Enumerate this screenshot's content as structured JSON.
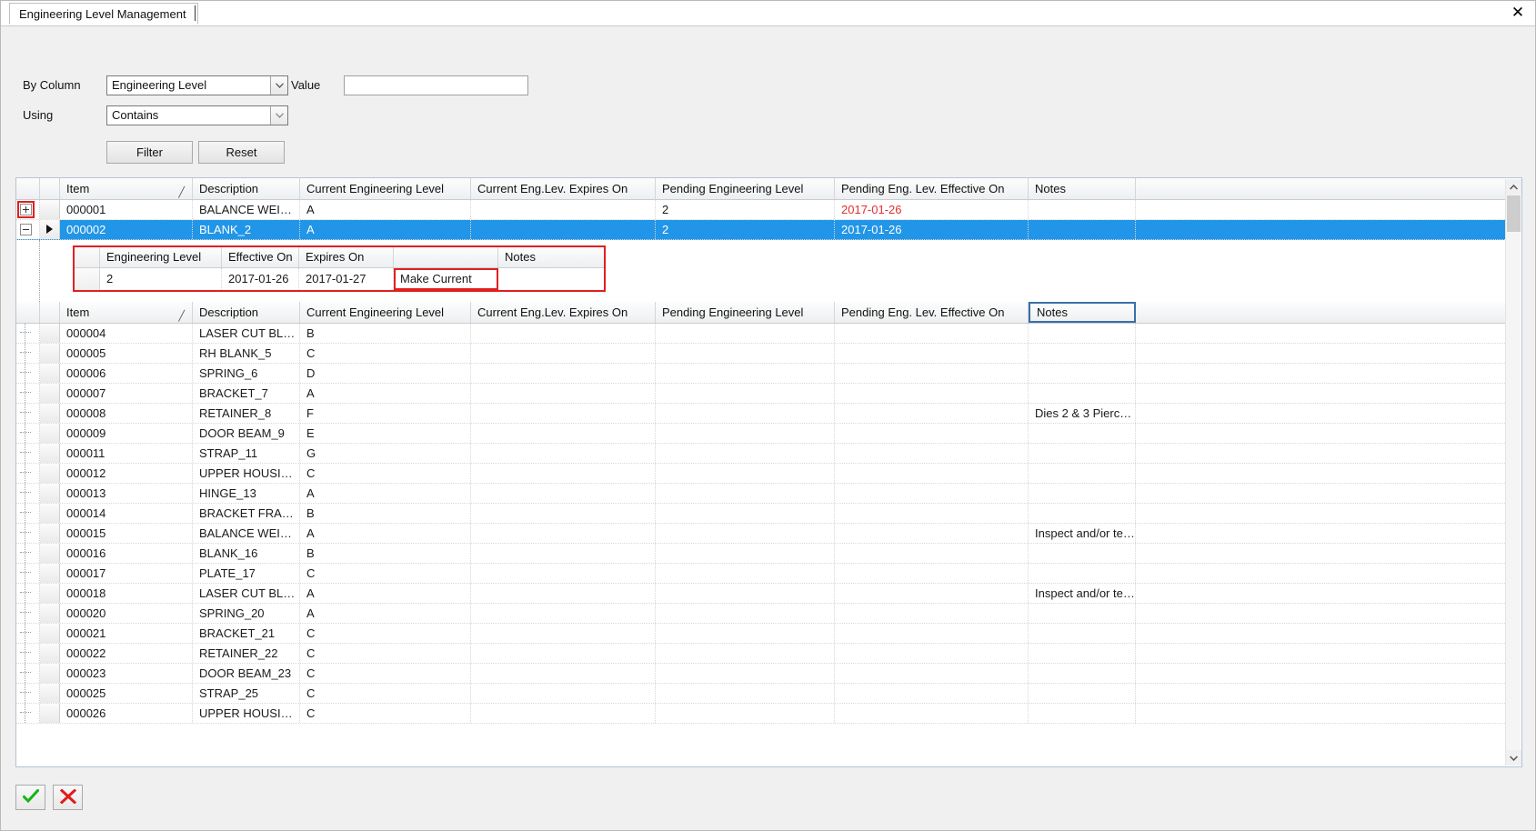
{
  "window": {
    "tab_title": "Engineering Level Management",
    "close_label": "✕"
  },
  "filter": {
    "by_column_label": "By Column",
    "using_label": "Using",
    "value_label": "Value",
    "by_column_value": "Engineering Level",
    "using_value": "Contains",
    "value_text": "",
    "value_placeholder": "",
    "filter_button": "Filter",
    "reset_button": "Reset"
  },
  "grid": {
    "columns": [
      "Item",
      "Description",
      "Current Engineering Level",
      "Current Eng.Lev. Expires On",
      "Pending Engineering Level",
      "Pending Eng. Lev. Effective On",
      "Notes"
    ],
    "sort_glyph": "╱",
    "focused_column": "Notes",
    "rows_top": [
      {
        "item": "000001",
        "description": "BALANCE  WEI…",
        "current_level": "A",
        "current_expires": "",
        "pending_level": "2",
        "pending_effective": "2017-01-26",
        "pending_effective_color": "#e03030",
        "notes": "",
        "expander": "plus",
        "expander_highlighted": true,
        "selected": false
      },
      {
        "item": "000002",
        "description": "BLANK_2",
        "current_level": "A",
        "current_expires": "",
        "pending_level": "2",
        "pending_effective": "2017-01-26",
        "pending_effective_color": "",
        "notes": "",
        "expander": "minus",
        "expander_highlighted": false,
        "selected": true
      }
    ],
    "rows_bottom": [
      {
        "item": "000004",
        "description": "LASER CUT BL…",
        "current_level": "B",
        "current_expires": "",
        "pending_level": "",
        "pending_effective": "",
        "notes": ""
      },
      {
        "item": "000005",
        "description": "RH BLANK_5",
        "current_level": "C",
        "current_expires": "",
        "pending_level": "",
        "pending_effective": "",
        "notes": ""
      },
      {
        "item": "000006",
        "description": "SPRING_6",
        "current_level": "D",
        "current_expires": "",
        "pending_level": "",
        "pending_effective": "",
        "notes": ""
      },
      {
        "item": "000007",
        "description": "BRACKET_7",
        "current_level": "A",
        "current_expires": "",
        "pending_level": "",
        "pending_effective": "",
        "notes": ""
      },
      {
        "item": "000008",
        "description": "RETAINER_8",
        "current_level": "F",
        "current_expires": "",
        "pending_level": "",
        "pending_effective": "",
        "notes": "Dies 2 & 3 Pierc…"
      },
      {
        "item": "000009",
        "description": "DOOR BEAM_9",
        "current_level": "E",
        "current_expires": "",
        "pending_level": "",
        "pending_effective": "",
        "notes": ""
      },
      {
        "item": "000011",
        "description": "STRAP_11",
        "current_level": "G",
        "current_expires": "",
        "pending_level": "",
        "pending_effective": "",
        "notes": ""
      },
      {
        "item": "000012",
        "description": "UPPER  HOUSI…",
        "current_level": "C",
        "current_expires": "",
        "pending_level": "",
        "pending_effective": "",
        "notes": ""
      },
      {
        "item": "000013",
        "description": "HINGE_13",
        "current_level": "A",
        "current_expires": "",
        "pending_level": "",
        "pending_effective": "",
        "notes": ""
      },
      {
        "item": "000014",
        "description": "BRACKET  FRA…",
        "current_level": "B",
        "current_expires": "",
        "pending_level": "",
        "pending_effective": "",
        "notes": ""
      },
      {
        "item": "000015",
        "description": "BALANCE  WEI…",
        "current_level": "A",
        "current_expires": "",
        "pending_level": "",
        "pending_effective": "",
        "notes": "Inspect and/or te…"
      },
      {
        "item": "000016",
        "description": "BLANK_16",
        "current_level": "B",
        "current_expires": "",
        "pending_level": "",
        "pending_effective": "",
        "notes": ""
      },
      {
        "item": "000017",
        "description": "PLATE_17",
        "current_level": "C",
        "current_expires": "",
        "pending_level": "",
        "pending_effective": "",
        "notes": ""
      },
      {
        "item": "000018",
        "description": "LASER CUT BL…",
        "current_level": "A",
        "current_expires": "",
        "pending_level": "",
        "pending_effective": "",
        "notes": "Inspect and/or te…"
      },
      {
        "item": "000020",
        "description": "SPRING_20",
        "current_level": "A",
        "current_expires": "",
        "pending_level": "",
        "pending_effective": "",
        "notes": ""
      },
      {
        "item": "000021",
        "description": "BRACKET_21",
        "current_level": "C",
        "current_expires": "",
        "pending_level": "",
        "pending_effective": "",
        "notes": ""
      },
      {
        "item": "000022",
        "description": "RETAINER_22",
        "current_level": "C",
        "current_expires": "",
        "pending_level": "",
        "pending_effective": "",
        "notes": ""
      },
      {
        "item": "000023",
        "description": "DOOR BEAM_23",
        "current_level": "C",
        "current_expires": "",
        "pending_level": "",
        "pending_effective": "",
        "notes": ""
      },
      {
        "item": "000025",
        "description": "STRAP_25",
        "current_level": "C",
        "current_expires": "",
        "pending_level": "",
        "pending_effective": "",
        "notes": ""
      },
      {
        "item": "000026",
        "description": "UPPER  HOUSI…",
        "current_level": "C",
        "current_expires": "",
        "pending_level": "",
        "pending_effective": "",
        "notes": ""
      }
    ]
  },
  "detail": {
    "columns": [
      "Engineering Level",
      "Effective On",
      "Expires On",
      "",
      "Notes"
    ],
    "row": {
      "engineering_level": "2",
      "effective_on": "2017-01-26",
      "expires_on": "2017-01-27",
      "action": "Make Current",
      "notes": ""
    }
  },
  "toolbar": {
    "accept_label": "accept-check-icon",
    "cancel_label": "cancel-cross-icon"
  },
  "colors": {
    "selection_blue": "#2196e8",
    "alert_red": "#e03030",
    "highlight_red": "#e02020",
    "focus_blue": "#3b6fa8",
    "panel_gray": "#f0f0f0"
  },
  "scrollbar": {
    "up_arrow": "▲",
    "down_arrow": "▼"
  }
}
